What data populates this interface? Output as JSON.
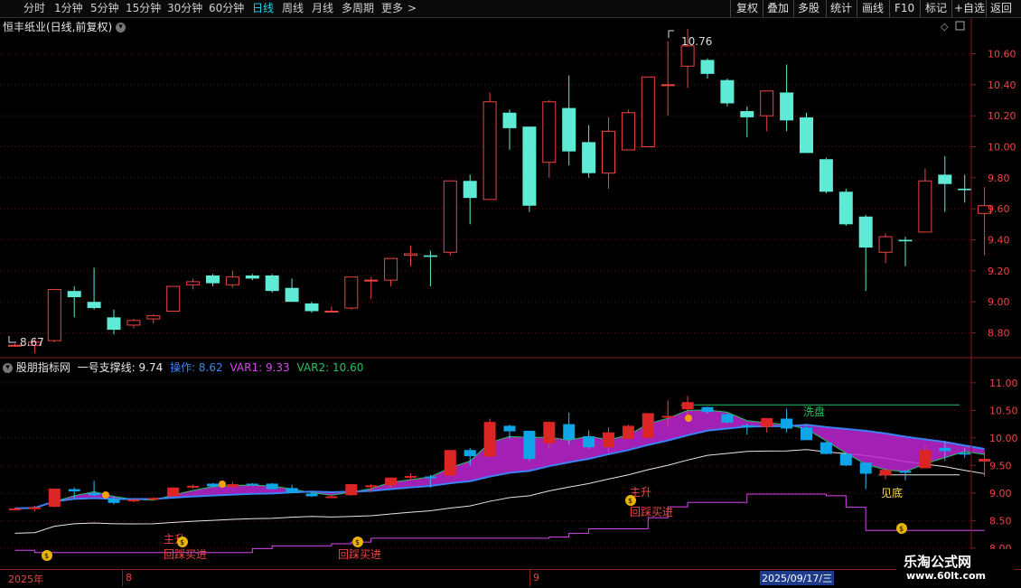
{
  "toolbar": {
    "periods": [
      "分时",
      "1分钟",
      "5分钟",
      "15分钟",
      "30分钟",
      "60分钟",
      "日线",
      "周线",
      "月线",
      "多周期",
      "更多"
    ],
    "active_period": "日线",
    "more_arrow": ">",
    "right_buttons": [
      "复权",
      "叠加",
      "多股",
      "统计",
      "画线",
      "F10",
      "标记",
      "+自选",
      "返回"
    ]
  },
  "main_chart": {
    "title": "恒丰纸业(日线,前复权)",
    "high_label": "10.76",
    "low_label": "8.67",
    "y_ticks": [
      "10.60",
      "10.40",
      "10.20",
      "10.00",
      "9.80",
      "9.60",
      "9.40",
      "9.20",
      "9.00",
      "8.80"
    ]
  },
  "indicator": {
    "name": "股朋指标网",
    "line1": "一号支撑线: 9.74",
    "line2": "操作: 8.62",
    "line3": "VAR1: 9.33",
    "line4": "VAR2: 10.60",
    "y_ticks": [
      "11.00",
      "10.50",
      "10.00",
      "9.50",
      "9.00",
      "8.50",
      "8.00"
    ],
    "labels": {
      "xipan": "洗盘",
      "jiandi": "见底",
      "zhusheng": "主升",
      "huicai1": "回踩买进",
      "huicai2": "回踩买进",
      "huicai3": "回踩买进",
      "zhu": "主升"
    }
  },
  "timeline": {
    "year": "2025年",
    "m8": "8",
    "m9": "9",
    "cursor_date": "2025/09/17/三"
  },
  "watermark": {
    "name": "乐淘公式网",
    "url": "www.60lt.com"
  },
  "chart_data": {
    "type": "candlestick",
    "candles": [
      {
        "o": 8.72,
        "h": 8.73,
        "l": 8.71,
        "c": 8.72
      },
      {
        "o": 8.72,
        "h": 8.77,
        "l": 8.67,
        "c": 8.74
      },
      {
        "o": 8.75,
        "h": 9.08,
        "l": 8.74,
        "c": 9.08
      },
      {
        "o": 9.07,
        "h": 9.1,
        "l": 8.9,
        "c": 9.03
      },
      {
        "o": 9.0,
        "h": 9.22,
        "l": 8.95,
        "c": 8.96
      },
      {
        "o": 8.9,
        "h": 8.95,
        "l": 8.79,
        "c": 8.82
      },
      {
        "o": 8.85,
        "h": 8.89,
        "l": 8.83,
        "c": 8.88
      },
      {
        "o": 8.89,
        "h": 8.92,
        "l": 8.86,
        "c": 8.91
      },
      {
        "o": 8.94,
        "h": 9.1,
        "l": 8.94,
        "c": 9.1
      },
      {
        "o": 9.11,
        "h": 9.15,
        "l": 9.08,
        "c": 9.13
      },
      {
        "o": 9.17,
        "h": 9.18,
        "l": 9.1,
        "c": 9.12
      },
      {
        "o": 9.11,
        "h": 9.2,
        "l": 9.09,
        "c": 9.16
      },
      {
        "o": 9.17,
        "h": 9.18,
        "l": 9.14,
        "c": 9.15
      },
      {
        "o": 9.17,
        "h": 9.18,
        "l": 9.06,
        "c": 9.07
      },
      {
        "o": 9.09,
        "h": 9.15,
        "l": 9.0,
        "c": 9.0
      },
      {
        "o": 8.99,
        "h": 9.0,
        "l": 8.93,
        "c": 8.94
      },
      {
        "o": 8.94,
        "h": 8.97,
        "l": 8.93,
        "c": 8.94
      },
      {
        "o": 8.96,
        "h": 9.16,
        "l": 8.95,
        "c": 9.16
      },
      {
        "o": 9.14,
        "h": 9.16,
        "l": 9.02,
        "c": 9.14
      },
      {
        "o": 9.14,
        "h": 9.28,
        "l": 9.1,
        "c": 9.28
      },
      {
        "o": 9.3,
        "h": 9.36,
        "l": 9.23,
        "c": 9.31
      },
      {
        "o": 9.3,
        "h": 9.33,
        "l": 9.1,
        "c": 9.29
      },
      {
        "o": 9.32,
        "h": 9.68,
        "l": 9.3,
        "c": 9.78
      },
      {
        "o": 9.78,
        "h": 9.82,
        "l": 9.5,
        "c": 9.67
      },
      {
        "o": 9.66,
        "h": 10.35,
        "l": 9.66,
        "c": 10.29
      },
      {
        "o": 10.22,
        "h": 10.24,
        "l": 9.98,
        "c": 10.12
      },
      {
        "o": 10.13,
        "h": 10.13,
        "l": 9.58,
        "c": 9.62
      },
      {
        "o": 9.9,
        "h": 10.3,
        "l": 9.8,
        "c": 10.29
      },
      {
        "o": 10.25,
        "h": 10.46,
        "l": 9.88,
        "c": 9.97
      },
      {
        "o": 10.03,
        "h": 10.14,
        "l": 9.8,
        "c": 9.83
      },
      {
        "o": 9.83,
        "h": 10.19,
        "l": 9.73,
        "c": 10.1
      },
      {
        "o": 9.98,
        "h": 10.24,
        "l": 9.98,
        "c": 10.22
      },
      {
        "o": 10.0,
        "h": 10.45,
        "l": 10.0,
        "c": 10.45
      },
      {
        "o": 10.4,
        "h": 10.68,
        "l": 10.2,
        "c": 10.4
      },
      {
        "o": 10.52,
        "h": 10.76,
        "l": 10.38,
        "c": 10.65
      },
      {
        "o": 10.56,
        "h": 10.57,
        "l": 10.44,
        "c": 10.47
      },
      {
        "o": 10.43,
        "h": 10.44,
        "l": 10.26,
        "c": 10.28
      },
      {
        "o": 10.23,
        "h": 10.26,
        "l": 10.06,
        "c": 10.19
      },
      {
        "o": 10.2,
        "h": 10.36,
        "l": 10.1,
        "c": 10.36
      },
      {
        "o": 10.35,
        "h": 10.53,
        "l": 10.1,
        "c": 10.17
      },
      {
        "o": 10.19,
        "h": 10.22,
        "l": 9.96,
        "c": 9.96
      },
      {
        "o": 9.92,
        "h": 9.93,
        "l": 9.7,
        "c": 9.71
      },
      {
        "o": 9.71,
        "h": 9.73,
        "l": 9.49,
        "c": 9.5
      },
      {
        "o": 9.55,
        "h": 9.56,
        "l": 9.07,
        "c": 9.35
      },
      {
        "o": 9.32,
        "h": 9.44,
        "l": 9.25,
        "c": 9.42
      },
      {
        "o": 9.4,
        "h": 9.42,
        "l": 9.23,
        "c": 9.39
      },
      {
        "o": 9.45,
        "h": 9.86,
        "l": 9.45,
        "c": 9.78
      },
      {
        "o": 9.82,
        "h": 9.94,
        "l": 9.58,
        "c": 9.76
      },
      {
        "o": 9.73,
        "h": 9.82,
        "l": 9.64,
        "c": 9.72
      },
      {
        "o": 9.57,
        "h": 9.74,
        "l": 9.3,
        "c": 9.62
      }
    ],
    "main_ylim": [
      8.64,
      10.83
    ],
    "ind_ylim": [
      7.62,
      11.44
    ],
    "ind_lines": {
      "xipan_level": 10.6,
      "var1_start": 8.35,
      "var1_end": 9.33,
      "op_start": 7.95,
      "op_end": 9.33
    }
  }
}
